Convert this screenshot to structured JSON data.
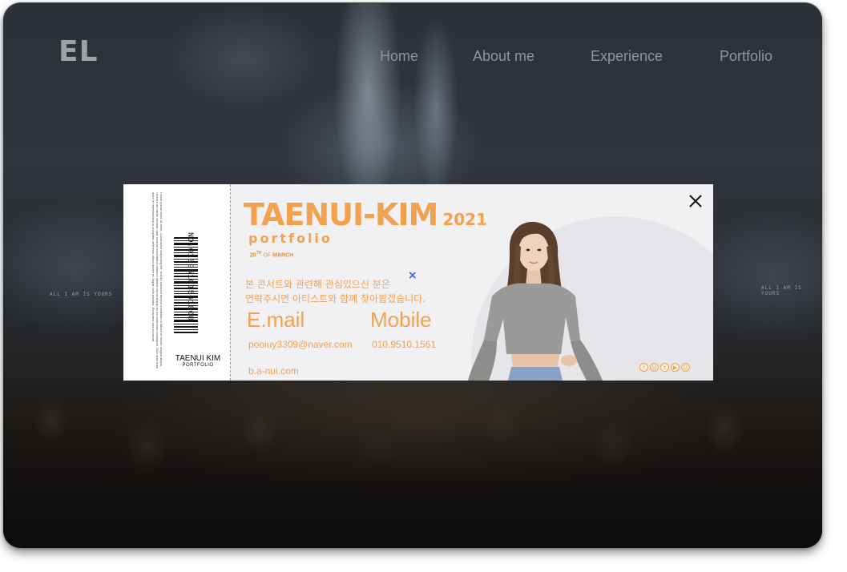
{
  "header": {
    "logo": "EL",
    "nav": [
      {
        "label": "Home"
      },
      {
        "label": "About me"
      },
      {
        "label": "Experience"
      },
      {
        "label": "Portfolio"
      }
    ]
  },
  "background": {
    "screen_text_left": "ALL I AM IS YOURS",
    "screen_text_right": "ALL I AM IS YOURS"
  },
  "ticket": {
    "stub": {
      "fineprint": "Lorem ipsum dolor sit amet, consectetur adipiscing elit, sed do eiusmod tempor incididunt ut labore et dolore magna aliqua. Ut enim ad minim veniam, quis nostrud exercitation ullamco laboris nisi ut aliquip ex ea commodo consequat. Duis aute irure dolor in reprehenderit in voluptate velit esse cillum dolore eu fugiat nulla pariatur. Excepteur sint occaecat.",
      "barcode_number": "NO.01095101561000",
      "name": "TAENUI KIM",
      "name_sub": "PORTFOLIO"
    },
    "title": "TAENUI-KIM",
    "year": "2021",
    "subtitle": "portfolio",
    "date_day": "20",
    "date_suffix": "TH",
    "date_of": "OF",
    "date_month": "MARCH",
    "message_line1": "본 콘서트와 관련해 관심있으신 분은",
    "message_line2": "연락주시면 아티스트와 함께 찾아뵙겠습니다.",
    "x_mark": "×",
    "email_label": "E.mail",
    "email_value": "pooiuy3309@naver.com",
    "mobile_label": "Mobile",
    "mobile_value": "010.9510.1561",
    "website": "b.a-nui.com",
    "socials": [
      {
        "icon": "facebook-icon",
        "glyph": "f"
      },
      {
        "icon": "instagram-icon",
        "glyph": "@"
      },
      {
        "icon": "twitter-icon",
        "glyph": "t"
      },
      {
        "icon": "youtube-icon",
        "glyph": "▶"
      },
      {
        "icon": "snapchat-icon",
        "glyph": "☺"
      }
    ],
    "accent_color": "#f2a14e"
  },
  "modal": {
    "close_icon": "close-icon"
  }
}
